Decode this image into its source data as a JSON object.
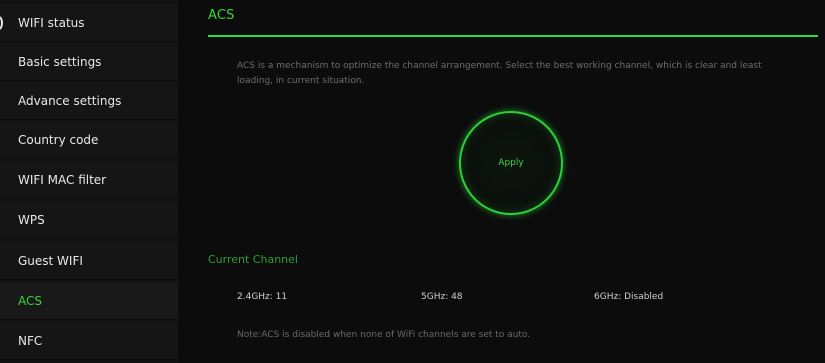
{
  "sidebar": {
    "items": [
      {
        "label": "WIFI status",
        "active": false
      },
      {
        "label": "Basic settings",
        "active": false
      },
      {
        "label": "Advance settings",
        "active": false
      },
      {
        "label": "Country code",
        "active": false
      },
      {
        "label": "WIFI MAC filter",
        "active": false
      },
      {
        "label": "WPS",
        "active": false
      },
      {
        "label": "Guest WIFI",
        "active": false
      },
      {
        "label": "ACS",
        "active": true
      },
      {
        "label": "NFC",
        "active": false
      }
    ]
  },
  "main": {
    "title": "ACS",
    "description": "ACS is a mechanism to optimize the channel arrangement. Select the best working channel, which is clear and least loading, in current situation.",
    "apply_label": "Apply",
    "current_channel": {
      "heading": "Current Channel",
      "band_24": "2.4GHz: 11",
      "band_5": "5GHz: 48",
      "band_6": "6GHz: Disabled"
    },
    "note": "Note:ACS is disabled when none of WiFi channels are set to auto."
  },
  "colors": {
    "accent": "#2cd03a",
    "background": "#0b0b0b",
    "sidebar": "#151515"
  }
}
